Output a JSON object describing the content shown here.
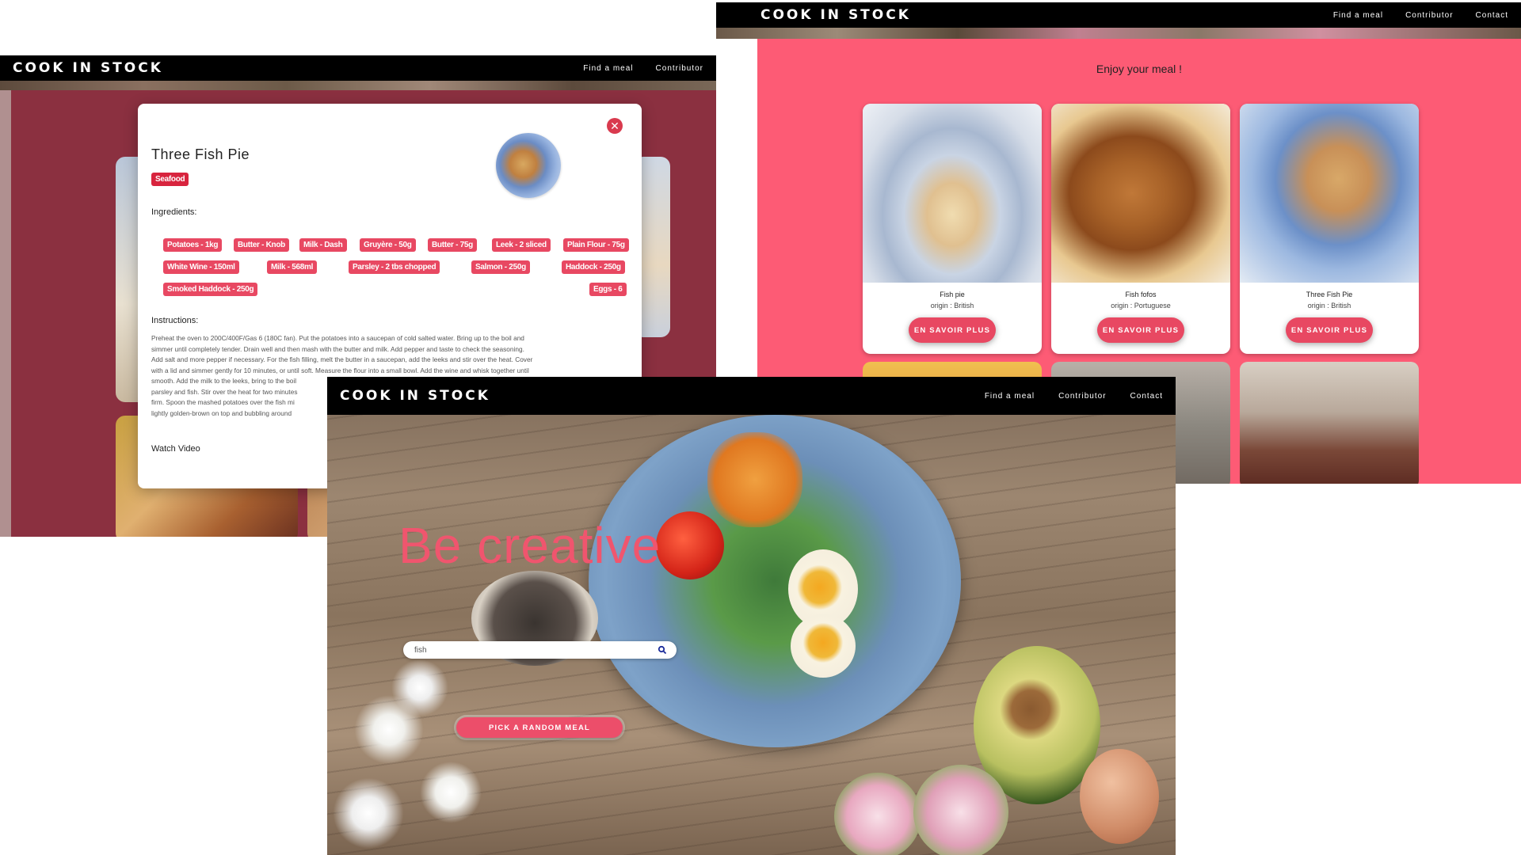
{
  "recipe": {
    "brand": "COOK IN STOCK",
    "nav": [
      "Find a meal",
      "Contributor"
    ],
    "title": "Three Fish Pie",
    "category": "Seafood",
    "ingredients_label": "Ingredients:",
    "ingredients": [
      "Potatoes - 1kg",
      "Butter - Knob",
      "Milk - Dash",
      "Gruyère - 50g",
      "Butter - 75g",
      "Leek - 2 sliced",
      "Plain Flour - 75g",
      "White Wine - 150ml",
      "Milk - 568ml",
      "Parsley - 2 tbs chopped",
      "Salmon - 250g",
      "Haddock - 250g",
      "Smoked Haddock - 250g",
      "Eggs - 6"
    ],
    "instructions_label": "Instructions:",
    "instructions": [
      "Preheat the oven to 200C/400F/Gas 6 (180C fan). Put the potatoes into a saucepan of cold salted water. Bring up to the boil and",
      "simmer until completely tender. Drain well and then mash with the butter and milk. Add pepper and taste to check the seasoning.",
      "Add salt and more pepper if necessary. For the fish filling, melt the butter in a saucepan, add the leeks and stir over the heat. Cover",
      "with a lid and simmer gently for 10 minutes, or until soft. Measure the flour into a small bowl. Add the wine and whisk together until",
      "smooth. Add the milk to the leeks, bring to the boil",
      "parsley and fish. Stir over the heat for two minutes",
      "firm. Spoon the mashed potatoes over the fish mi",
      "lightly golden-brown on top and bubbling around"
    ],
    "video_label": "Watch Video",
    "close_icon": "close-icon",
    "accent": "#e84862",
    "backdrop": "#8b3040"
  },
  "results": {
    "brand": "COOK IN STOCK",
    "nav": [
      "Find a meal",
      "Contributor",
      "Contact"
    ],
    "heading": "Enjoy your meal !",
    "bg": "#fd5b75",
    "cards": [
      {
        "name": "Fish pie",
        "origin": "origin : British",
        "button": "EN SAVOIR PLUS"
      },
      {
        "name": "Fish fofos",
        "origin": "origin : Portuguese",
        "button": "EN SAVOIR PLUS"
      },
      {
        "name": "Three Fish Pie",
        "origin": "origin : British",
        "button": "EN SAVOIR PLUS"
      }
    ]
  },
  "home": {
    "brand": "COOK IN STOCK",
    "nav": [
      "Find a meal",
      "Contributor",
      "Contact"
    ],
    "hero": "Be creative",
    "search_value": "fish",
    "search_icon": "search-icon",
    "random_button": "PICK A RANDOM MEAL"
  }
}
